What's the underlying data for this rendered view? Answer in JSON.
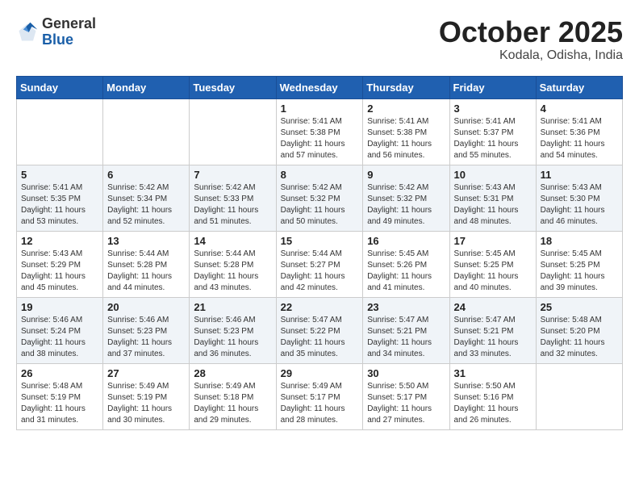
{
  "header": {
    "logo_general": "General",
    "logo_blue": "Blue",
    "month_title": "October 2025",
    "location": "Kodala, Odisha, India"
  },
  "days_of_week": [
    "Sunday",
    "Monday",
    "Tuesday",
    "Wednesday",
    "Thursday",
    "Friday",
    "Saturday"
  ],
  "weeks": [
    {
      "days": [
        {
          "number": "",
          "info": ""
        },
        {
          "number": "",
          "info": ""
        },
        {
          "number": "",
          "info": ""
        },
        {
          "number": "1",
          "info": "Sunrise: 5:41 AM\nSunset: 5:38 PM\nDaylight: 11 hours\nand 57 minutes."
        },
        {
          "number": "2",
          "info": "Sunrise: 5:41 AM\nSunset: 5:38 PM\nDaylight: 11 hours\nand 56 minutes."
        },
        {
          "number": "3",
          "info": "Sunrise: 5:41 AM\nSunset: 5:37 PM\nDaylight: 11 hours\nand 55 minutes."
        },
        {
          "number": "4",
          "info": "Sunrise: 5:41 AM\nSunset: 5:36 PM\nDaylight: 11 hours\nand 54 minutes."
        }
      ]
    },
    {
      "days": [
        {
          "number": "5",
          "info": "Sunrise: 5:41 AM\nSunset: 5:35 PM\nDaylight: 11 hours\nand 53 minutes."
        },
        {
          "number": "6",
          "info": "Sunrise: 5:42 AM\nSunset: 5:34 PM\nDaylight: 11 hours\nand 52 minutes."
        },
        {
          "number": "7",
          "info": "Sunrise: 5:42 AM\nSunset: 5:33 PM\nDaylight: 11 hours\nand 51 minutes."
        },
        {
          "number": "8",
          "info": "Sunrise: 5:42 AM\nSunset: 5:32 PM\nDaylight: 11 hours\nand 50 minutes."
        },
        {
          "number": "9",
          "info": "Sunrise: 5:42 AM\nSunset: 5:32 PM\nDaylight: 11 hours\nand 49 minutes."
        },
        {
          "number": "10",
          "info": "Sunrise: 5:43 AM\nSunset: 5:31 PM\nDaylight: 11 hours\nand 48 minutes."
        },
        {
          "number": "11",
          "info": "Sunrise: 5:43 AM\nSunset: 5:30 PM\nDaylight: 11 hours\nand 46 minutes."
        }
      ]
    },
    {
      "days": [
        {
          "number": "12",
          "info": "Sunrise: 5:43 AM\nSunset: 5:29 PM\nDaylight: 11 hours\nand 45 minutes."
        },
        {
          "number": "13",
          "info": "Sunrise: 5:44 AM\nSunset: 5:28 PM\nDaylight: 11 hours\nand 44 minutes."
        },
        {
          "number": "14",
          "info": "Sunrise: 5:44 AM\nSunset: 5:28 PM\nDaylight: 11 hours\nand 43 minutes."
        },
        {
          "number": "15",
          "info": "Sunrise: 5:44 AM\nSunset: 5:27 PM\nDaylight: 11 hours\nand 42 minutes."
        },
        {
          "number": "16",
          "info": "Sunrise: 5:45 AM\nSunset: 5:26 PM\nDaylight: 11 hours\nand 41 minutes."
        },
        {
          "number": "17",
          "info": "Sunrise: 5:45 AM\nSunset: 5:25 PM\nDaylight: 11 hours\nand 40 minutes."
        },
        {
          "number": "18",
          "info": "Sunrise: 5:45 AM\nSunset: 5:25 PM\nDaylight: 11 hours\nand 39 minutes."
        }
      ]
    },
    {
      "days": [
        {
          "number": "19",
          "info": "Sunrise: 5:46 AM\nSunset: 5:24 PM\nDaylight: 11 hours\nand 38 minutes."
        },
        {
          "number": "20",
          "info": "Sunrise: 5:46 AM\nSunset: 5:23 PM\nDaylight: 11 hours\nand 37 minutes."
        },
        {
          "number": "21",
          "info": "Sunrise: 5:46 AM\nSunset: 5:23 PM\nDaylight: 11 hours\nand 36 minutes."
        },
        {
          "number": "22",
          "info": "Sunrise: 5:47 AM\nSunset: 5:22 PM\nDaylight: 11 hours\nand 35 minutes."
        },
        {
          "number": "23",
          "info": "Sunrise: 5:47 AM\nSunset: 5:21 PM\nDaylight: 11 hours\nand 34 minutes."
        },
        {
          "number": "24",
          "info": "Sunrise: 5:47 AM\nSunset: 5:21 PM\nDaylight: 11 hours\nand 33 minutes."
        },
        {
          "number": "25",
          "info": "Sunrise: 5:48 AM\nSunset: 5:20 PM\nDaylight: 11 hours\nand 32 minutes."
        }
      ]
    },
    {
      "days": [
        {
          "number": "26",
          "info": "Sunrise: 5:48 AM\nSunset: 5:19 PM\nDaylight: 11 hours\nand 31 minutes."
        },
        {
          "number": "27",
          "info": "Sunrise: 5:49 AM\nSunset: 5:19 PM\nDaylight: 11 hours\nand 30 minutes."
        },
        {
          "number": "28",
          "info": "Sunrise: 5:49 AM\nSunset: 5:18 PM\nDaylight: 11 hours\nand 29 minutes."
        },
        {
          "number": "29",
          "info": "Sunrise: 5:49 AM\nSunset: 5:17 PM\nDaylight: 11 hours\nand 28 minutes."
        },
        {
          "number": "30",
          "info": "Sunrise: 5:50 AM\nSunset: 5:17 PM\nDaylight: 11 hours\nand 27 minutes."
        },
        {
          "number": "31",
          "info": "Sunrise: 5:50 AM\nSunset: 5:16 PM\nDaylight: 11 hours\nand 26 minutes."
        },
        {
          "number": "",
          "info": ""
        }
      ]
    }
  ]
}
